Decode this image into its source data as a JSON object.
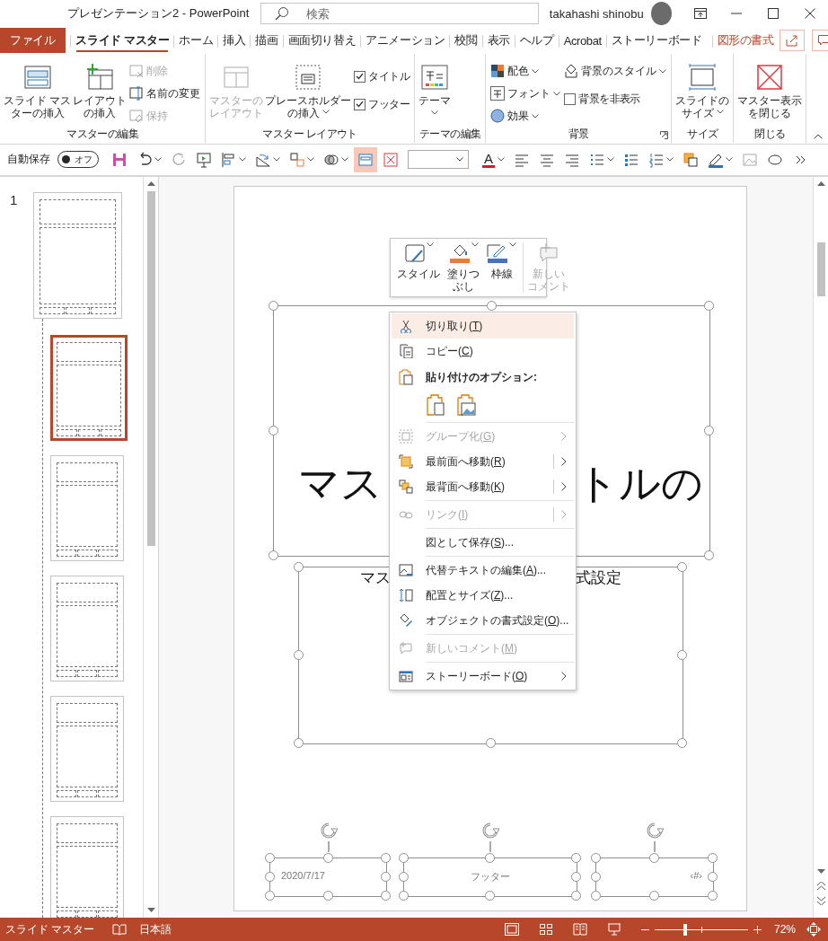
{
  "window": {
    "title": "プレゼンテーション2 - PowerPoint",
    "search_placeholder": "検索",
    "user_name": "takahashi shinobu"
  },
  "tabs": [
    {
      "label": "ファイル",
      "kind": "file",
      "selected": false
    },
    {
      "label": "スライド マスター",
      "kind": "normal",
      "selected": true
    },
    {
      "label": "ホーム",
      "kind": "normal",
      "selected": false
    },
    {
      "label": "挿入",
      "kind": "normal",
      "selected": false
    },
    {
      "label": "描画",
      "kind": "normal",
      "selected": false
    },
    {
      "label": "画面切り替え",
      "kind": "normal",
      "selected": false
    },
    {
      "label": "アニメーション",
      "kind": "normal",
      "selected": false
    },
    {
      "label": "校閲",
      "kind": "normal",
      "selected": false
    },
    {
      "label": "表示",
      "kind": "normal",
      "selected": false
    },
    {
      "label": "ヘルプ",
      "kind": "normal",
      "selected": false
    },
    {
      "label": "Acrobat",
      "kind": "normal",
      "selected": false
    },
    {
      "label": "ストーリーボード",
      "kind": "normal",
      "selected": false
    },
    {
      "label": "図形の書式",
      "kind": "contextual",
      "selected": false
    }
  ],
  "ribbon": {
    "groups": [
      {
        "label": "マスターの編集",
        "launcher": false,
        "columns": [
          [
            {
              "kind": "large",
              "lines": [
                "スライド マス",
                "ターの挿入"
              ],
              "disabled": false,
              "dropdown": false
            }
          ],
          [
            {
              "kind": "large",
              "lines": [
                "レイアウト",
                "の挿入"
              ],
              "disabled": false,
              "dropdown": false
            }
          ],
          [
            {
              "kind": "small",
              "label": "削除",
              "disabled": true,
              "dropdown": false
            },
            {
              "kind": "small",
              "label": "名前の変更",
              "disabled": false,
              "dropdown": false
            },
            {
              "kind": "small",
              "label": "保持",
              "disabled": true,
              "dropdown": false
            }
          ]
        ]
      },
      {
        "label": "マスター レイアウト",
        "launcher": false,
        "columns": [
          [
            {
              "kind": "large",
              "lines": [
                "マスターの",
                "レイアウト"
              ],
              "disabled": true,
              "dropdown": false
            }
          ],
          [
            {
              "kind": "large",
              "lines": [
                "プレースホルダー",
                "の挿入"
              ],
              "disabled": false,
              "dropdown": true
            }
          ],
          [
            {
              "kind": "check",
              "label": "タイトル",
              "checked": true
            },
            {
              "kind": "check",
              "label": "フッター",
              "checked": true
            }
          ]
        ]
      },
      {
        "label": "テーマの編集",
        "launcher": false,
        "columns": [
          [
            {
              "kind": "large",
              "lines": [
                "テーマ"
              ],
              "disabled": false,
              "dropdown": true
            }
          ]
        ]
      },
      {
        "label": "背景",
        "launcher": true,
        "columns": [
          [
            {
              "kind": "small",
              "label": "配色",
              "disabled": false,
              "dropdown": true
            },
            {
              "kind": "small",
              "label": "フォント",
              "disabled": false,
              "dropdown": true
            },
            {
              "kind": "small",
              "label": "効果",
              "disabled": false,
              "dropdown": true
            }
          ],
          [
            {
              "kind": "small",
              "label": "背景のスタイル",
              "disabled": false,
              "dropdown": true
            },
            {
              "kind": "check",
              "label": "背景を非表示",
              "checked": false
            }
          ]
        ]
      },
      {
        "label": "サイズ",
        "launcher": false,
        "columns": [
          [
            {
              "kind": "large",
              "lines": [
                "スライドの",
                "サイズ"
              ],
              "disabled": false,
              "dropdown": true
            }
          ]
        ]
      },
      {
        "label": "閉じる",
        "launcher": false,
        "columns": [
          [
            {
              "kind": "large",
              "lines": [
                "マスター表示",
                "を閉じる"
              ],
              "disabled": false,
              "dropdown": false
            }
          ]
        ]
      }
    ]
  },
  "qat": {
    "autosave_label": "自動保存",
    "autosave": {
      "label": "オフ",
      "on": false
    },
    "frame_button_on": true,
    "font_color_label": "A"
  },
  "thumbnails": [
    {
      "number": "1",
      "selected": false
    },
    {
      "selected": true
    },
    {
      "selected": false
    },
    {
      "selected": false
    },
    {
      "selected": false
    },
    {
      "selected": false
    }
  ],
  "mini_toolbar": [
    {
      "lines": [
        "スタイル"
      ],
      "disabled": false,
      "dropdown": true
    },
    {
      "lines": [
        "塗りつ",
        "ぶし"
      ],
      "disabled": false,
      "dropdown": true
    },
    {
      "lines": [
        "枠線"
      ],
      "disabled": false,
      "dropdown": true
    },
    {
      "lines": [
        "新しい",
        "コメント"
      ],
      "disabled": true,
      "dropdown": false
    }
  ],
  "slide": {
    "title_parts": [
      "マス",
      "トルの"
    ],
    "subtitle_parts": [
      "マス",
      "式設定"
    ],
    "footers": [
      {
        "text": "2020/7/17"
      },
      {
        "text": "フッター"
      },
      {
        "text": "‹#›"
      }
    ]
  },
  "context_menu": [
    {
      "kind": "item",
      "before": "切り取り(",
      "key": "T",
      "after": ")",
      "selected": true,
      "disabled": false,
      "submenu": false,
      "split": false
    },
    {
      "kind": "item",
      "before": "コピー(",
      "key": "C",
      "after": ")",
      "selected": false,
      "disabled": false,
      "submenu": false,
      "split": false
    },
    {
      "kind": "header",
      "label": "貼り付けのオプション:"
    },
    {
      "kind": "paste-options"
    },
    {
      "kind": "separator"
    },
    {
      "kind": "item",
      "before": "グループ化(",
      "key": "G",
      "after": ")",
      "selected": false,
      "disabled": true,
      "submenu": true,
      "split": false
    },
    {
      "kind": "item",
      "before": "最前面へ移動(",
      "key": "R",
      "after": ")",
      "selected": false,
      "disabled": false,
      "submenu": true,
      "split": true
    },
    {
      "kind": "item",
      "before": "最背面へ移動(",
      "key": "K",
      "after": ")",
      "selected": false,
      "disabled": false,
      "submenu": true,
      "split": true
    },
    {
      "kind": "separator"
    },
    {
      "kind": "item",
      "before": "リンク(",
      "key": "I",
      "after": ")",
      "selected": false,
      "disabled": true,
      "submenu": true,
      "split": true
    },
    {
      "kind": "separator"
    },
    {
      "kind": "item",
      "before": "図として保存(",
      "key": "S",
      "after": ")...",
      "selected": false,
      "disabled": false,
      "submenu": false,
      "split": false
    },
    {
      "kind": "separator"
    },
    {
      "kind": "item",
      "before": "代替テキストの編集(",
      "key": "A",
      "after": ")...",
      "selected": false,
      "disabled": false,
      "submenu": false,
      "split": false
    },
    {
      "kind": "item",
      "before": "配置とサイズ(",
      "key": "Z",
      "after": ")...",
      "selected": false,
      "disabled": false,
      "submenu": false,
      "split": false
    },
    {
      "kind": "item",
      "before": "オブジェクトの書式設定(",
      "key": "O",
      "after": ")...",
      "selected": false,
      "disabled": false,
      "submenu": false,
      "split": false
    },
    {
      "kind": "separator"
    },
    {
      "kind": "item",
      "before": "新しいコメント(",
      "key": "M",
      "after": ")",
      "selected": false,
      "disabled": true,
      "submenu": false,
      "split": false
    },
    {
      "kind": "separator"
    },
    {
      "kind": "item",
      "before": "ストーリーボード(",
      "key": "O",
      "after": ")",
      "selected": false,
      "disabled": false,
      "submenu": true,
      "split": false
    }
  ],
  "status_bar": {
    "view_label": "スライド マスター",
    "language": "日本語",
    "zoom": {
      "level": 0.33,
      "reading": "72%"
    }
  }
}
